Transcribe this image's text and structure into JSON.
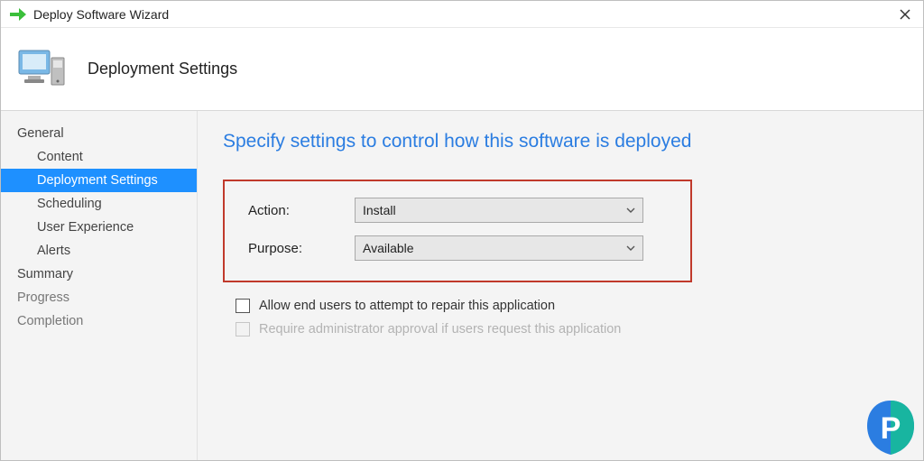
{
  "window": {
    "title": "Deploy Software Wizard"
  },
  "header": {
    "heading": "Deployment Settings"
  },
  "sidebar": {
    "items": [
      {
        "label": "General",
        "child": false,
        "selected": false,
        "dim": false
      },
      {
        "label": "Content",
        "child": true,
        "selected": false,
        "dim": false
      },
      {
        "label": "Deployment Settings",
        "child": true,
        "selected": true,
        "dim": false
      },
      {
        "label": "Scheduling",
        "child": true,
        "selected": false,
        "dim": false
      },
      {
        "label": "User Experience",
        "child": true,
        "selected": false,
        "dim": false
      },
      {
        "label": "Alerts",
        "child": true,
        "selected": false,
        "dim": false
      },
      {
        "label": "Summary",
        "child": false,
        "selected": false,
        "dim": false
      },
      {
        "label": "Progress",
        "child": false,
        "selected": false,
        "dim": true
      },
      {
        "label": "Completion",
        "child": false,
        "selected": false,
        "dim": true
      }
    ]
  },
  "main": {
    "title": "Specify settings to control how this software is deployed",
    "form": {
      "action_label": "Action:",
      "action_value": "Install",
      "purpose_label": "Purpose:",
      "purpose_value": "Available"
    },
    "checks": {
      "repair_label": "Allow end users to attempt to repair this application",
      "approval_label": "Require administrator approval if users request this application"
    }
  }
}
